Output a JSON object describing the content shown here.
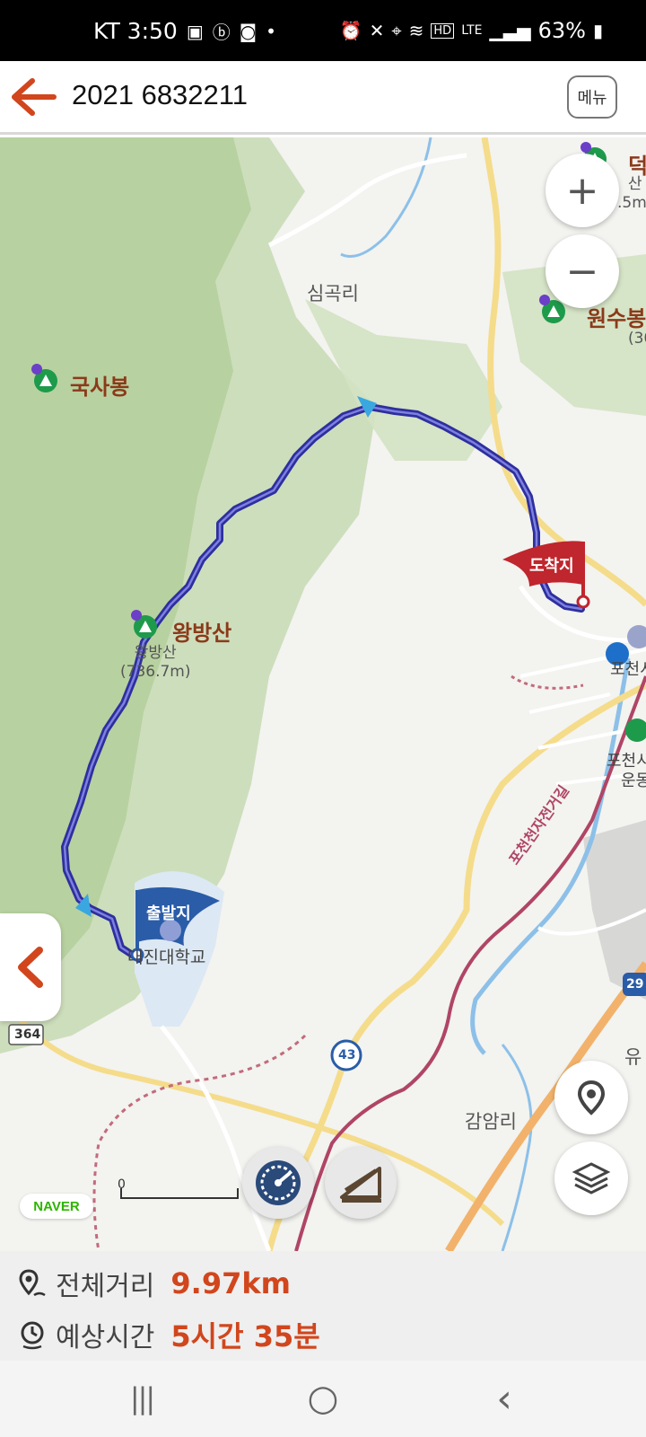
{
  "status_bar": {
    "carrier_time": "KT 3:50",
    "battery": "63%",
    "left_icons": [
      "gallery-icon",
      "b-app-icon",
      "app-icon",
      "dot-icon"
    ],
    "right_icons": [
      "alarm-icon",
      "mute-icon",
      "location-icon",
      "wifi-icon",
      "hd-icon",
      "lte-icon",
      "signal-icon",
      "battery-icon"
    ],
    "hd_text": "HD",
    "lte_text": "LTE"
  },
  "app_bar": {
    "title": "2021 6832211",
    "menu_label": "메뉴",
    "accent": "#d1461d"
  },
  "map": {
    "places": {
      "simgok": "심곡리",
      "gamam": "감암리",
      "yu": "유"
    },
    "peaks": {
      "guksabong": "국사봉",
      "wangbangsan": "왕방산",
      "wonsubong": "원수봉",
      "deok": "덕"
    },
    "peak_details": {
      "wangbangsan_name": "왕방산",
      "wangbangsan_height": "(736.7m)",
      "deok_name": "산",
      "deok_height": ".5m)",
      "wonsubong_height": "(30"
    },
    "poi": {
      "university": "대진대학교",
      "pocheon": "포천시",
      "pocheon_sports1": "포천시",
      "pocheon_sports2": "운동"
    },
    "road_labels": {
      "bike_road": "포천천자전거길",
      "r364": "364",
      "r43": "43",
      "r29": "29"
    },
    "start_flag": "출발지",
    "end_flag": "도착지",
    "naver_logo": "NAVER",
    "scale_zero": "0",
    "zoom_in": "+",
    "zoom_out": "−",
    "route_color": "#2e2f9e",
    "start_color": "#2a5ca8",
    "end_color": "#c0262d"
  },
  "summary": {
    "distance_label": "전체거리",
    "distance_value": "9.97km",
    "time_label": "예상시간",
    "time_value": "5시간 35분"
  },
  "nav": {
    "recents": "|||",
    "home": "○",
    "back": "‹"
  }
}
